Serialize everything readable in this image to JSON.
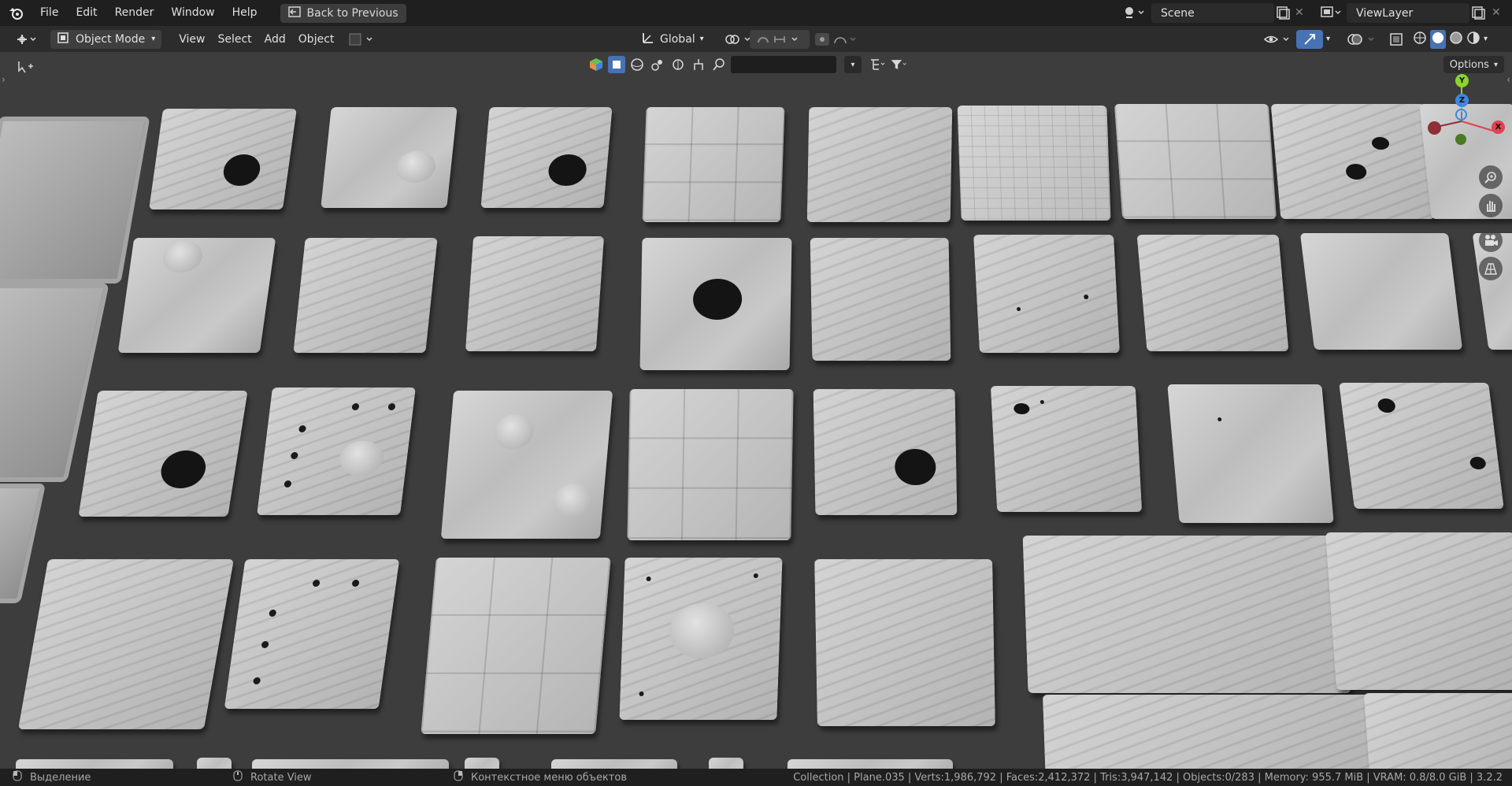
{
  "menu": [
    "File",
    "Edit",
    "Render",
    "Window",
    "Help"
  ],
  "back_button": "Back to Previous",
  "scene": {
    "label": "Scene"
  },
  "view_layer": {
    "label": "ViewLayer"
  },
  "header": {
    "mode": "Object Mode",
    "items": [
      "View",
      "Select",
      "Add",
      "Object"
    ],
    "transform_orientation": "Global",
    "options": "Options"
  },
  "status": {
    "left_action": "Выделение",
    "middle_action": "Rotate View",
    "right_action": "Контекстное меню объектов",
    "stats": "Collection | Plane.035 | Verts:1,986,792 | Faces:2,412,372 | Tris:3,947,142 | Objects:0/283 | Memory: 955.7 MiB | VRAM: 0.8/8.0 GiB | 3.2.2"
  },
  "gizmo": {
    "x": "X",
    "y": "Y",
    "z": "Z"
  },
  "colors": {
    "accent": "#4772b3",
    "topbar": "#1f1f1f",
    "viewport": "#3d3d3d",
    "gizmo_x": "#e0424e",
    "gizmo_y": "#8bd42e",
    "gizmo_z": "#3e87e0"
  },
  "icons": [
    "blender-logo-icon",
    "back-icon",
    "scene-icon",
    "viewlayer-icon",
    "object-mode-icon",
    "orientation-icon",
    "snap-icon",
    "proportional-icon",
    "filter-icon",
    "search-icon",
    "zoom-icon",
    "hand-icon",
    "camera-icon",
    "grid-icon",
    "mouse-icon"
  ]
}
